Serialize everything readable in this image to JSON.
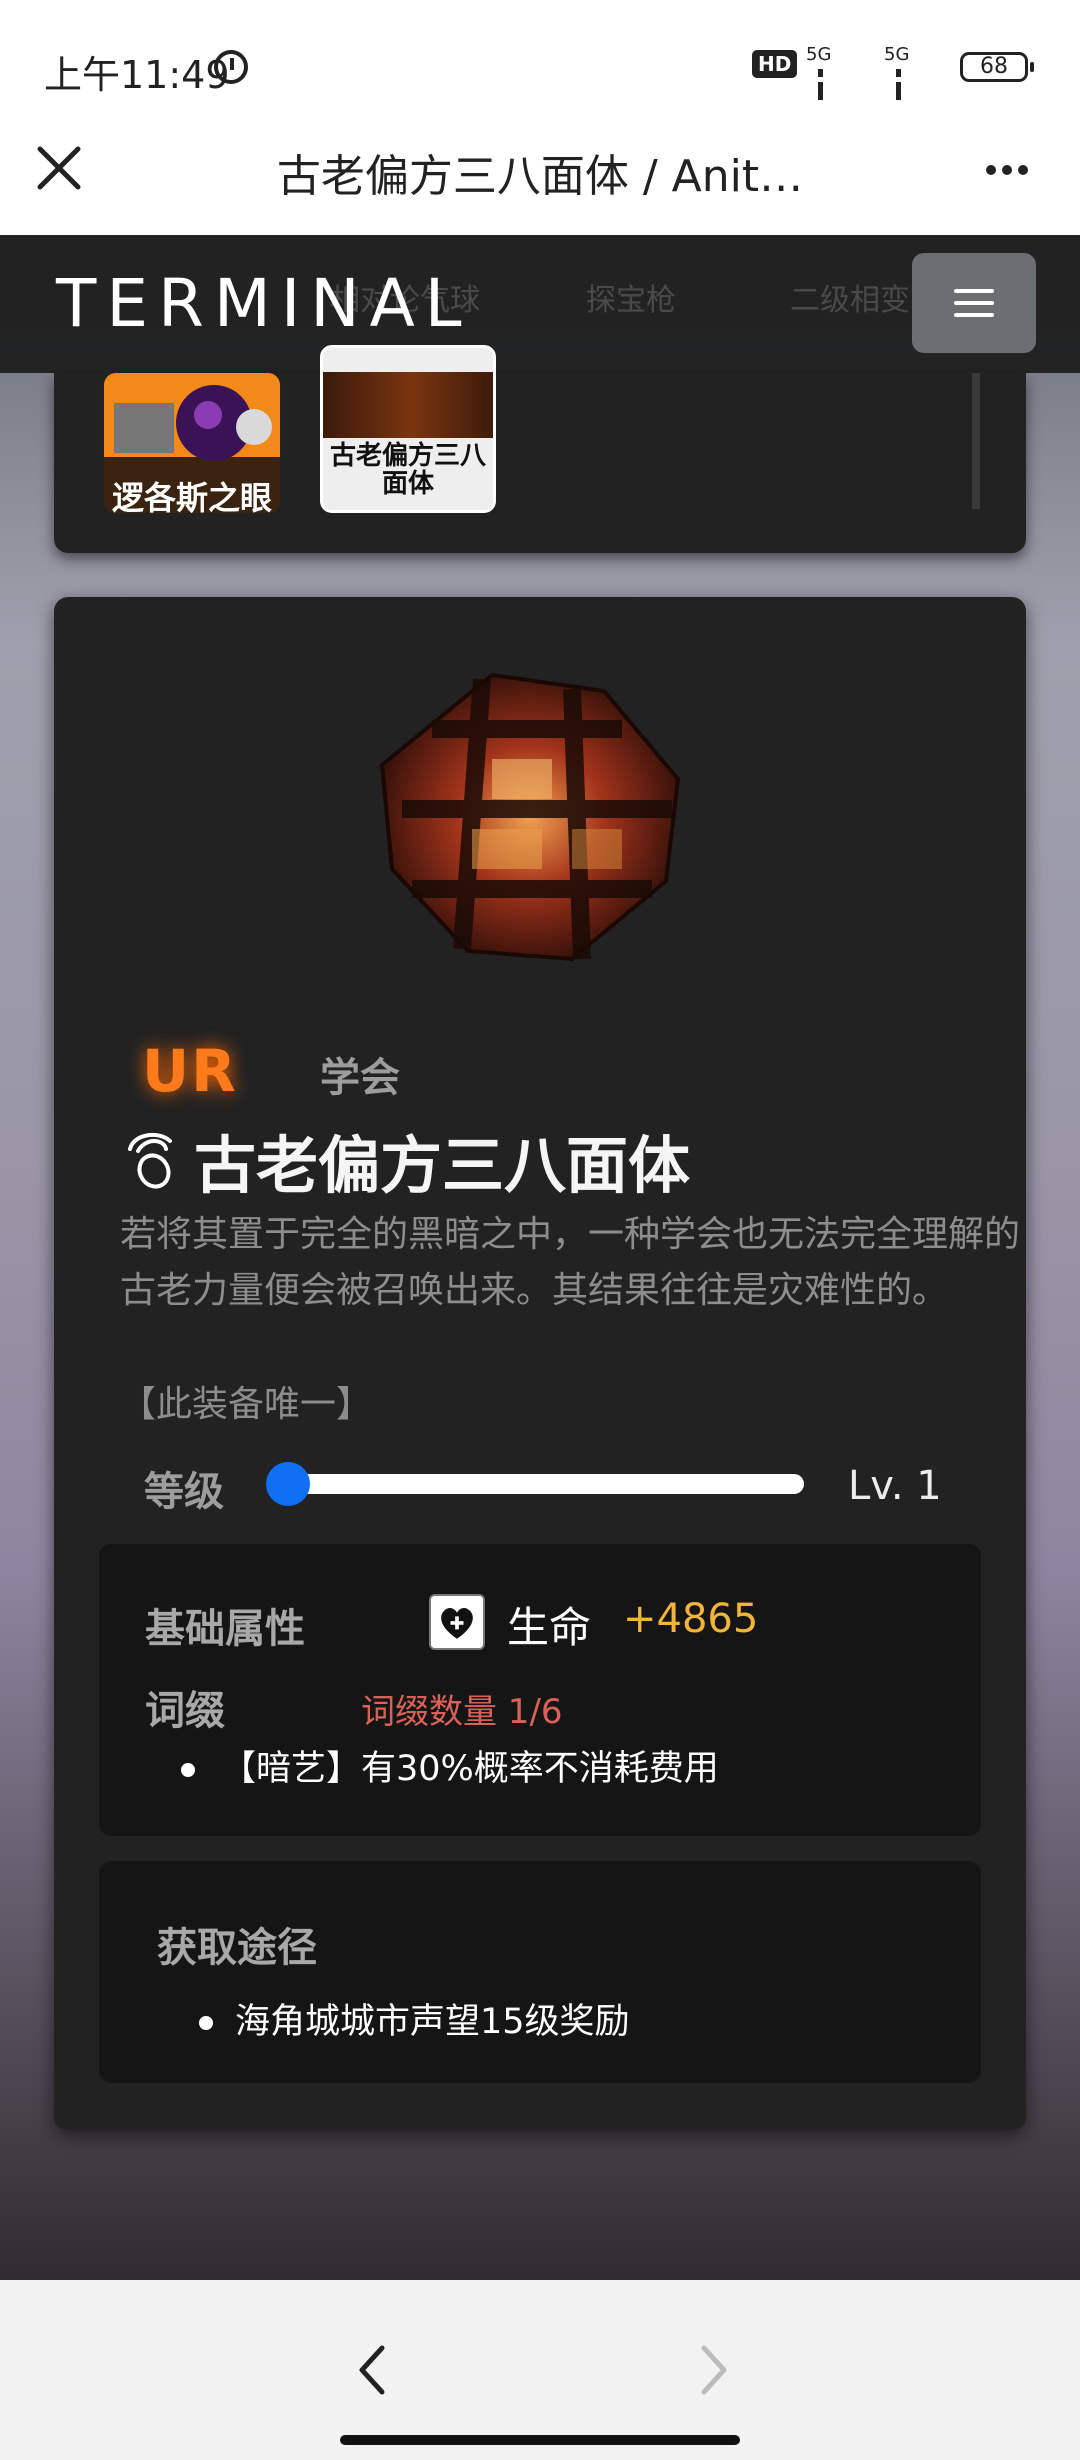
{
  "status": {
    "time": "上午11:49",
    "hd": "HD",
    "net1": "5G",
    "net2": "5G",
    "battery": "68"
  },
  "nav": {
    "title": "古老偏方三八面体 / Anit…"
  },
  "terminal": {
    "brand": "TERMINAL",
    "bg_tabs": [
      "相对论气球",
      "探宝枪",
      "二级相变"
    ]
  },
  "equip_list": [
    {
      "label": "逻各斯之眼",
      "selected": false
    },
    {
      "label": "古老偏方三八面体",
      "selected": true
    }
  ],
  "item": {
    "rarity": "UR",
    "faction": "学会",
    "name": "古老偏方三八面体",
    "description": "若将其置于完全的黑暗之中，一种学会也无法完全理解的古老力量便会被召唤出来。其结果往往是灾难性的。",
    "unique_note": "【此装备唯一】",
    "level_label": "等级",
    "level_value": "Lv. 1",
    "level_progress": 0
  },
  "attributes": {
    "base_label": "基础属性",
    "stat_name": "生命",
    "stat_value": "+4865",
    "affix_label": "词缀",
    "affix_count": "词缀数量 1/6",
    "affixes": [
      "【暗艺】有30%概率不消耗费用"
    ]
  },
  "source": {
    "label": "获取途径",
    "items": [
      "海角城城市声望15级奖励"
    ]
  },
  "colors": {
    "rarity": "#ff7a1a",
    "stat_value": "#f3b43a",
    "affix_count": "#d9615a",
    "slider": "#0f6ff5"
  }
}
